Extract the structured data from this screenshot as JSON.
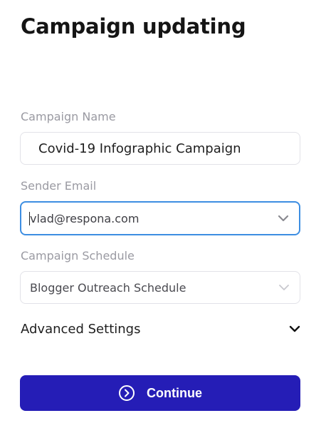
{
  "page": {
    "title": "Campaign updating"
  },
  "form": {
    "campaign_name": {
      "label": "Campaign Name",
      "value": "Covid-19 Infographic Campaign"
    },
    "sender_email": {
      "label": "Sender Email",
      "value": "vlad@respona.com",
      "icon": "chevron-down-icon"
    },
    "campaign_schedule": {
      "label": "Campaign Schedule",
      "value": "Blogger Outreach Schedule",
      "icon": "chevron-down-icon"
    },
    "advanced_settings": {
      "label": "Advanced Settings",
      "icon": "chevron-down-icon"
    }
  },
  "actions": {
    "continue_label": "Continue",
    "continue_icon": "circle-arrow-right-icon"
  },
  "colors": {
    "primary_button": "#251db6",
    "focus_border": "#3d8ee2",
    "label_text": "#9a9aa2",
    "field_border": "#e2e2e8"
  }
}
